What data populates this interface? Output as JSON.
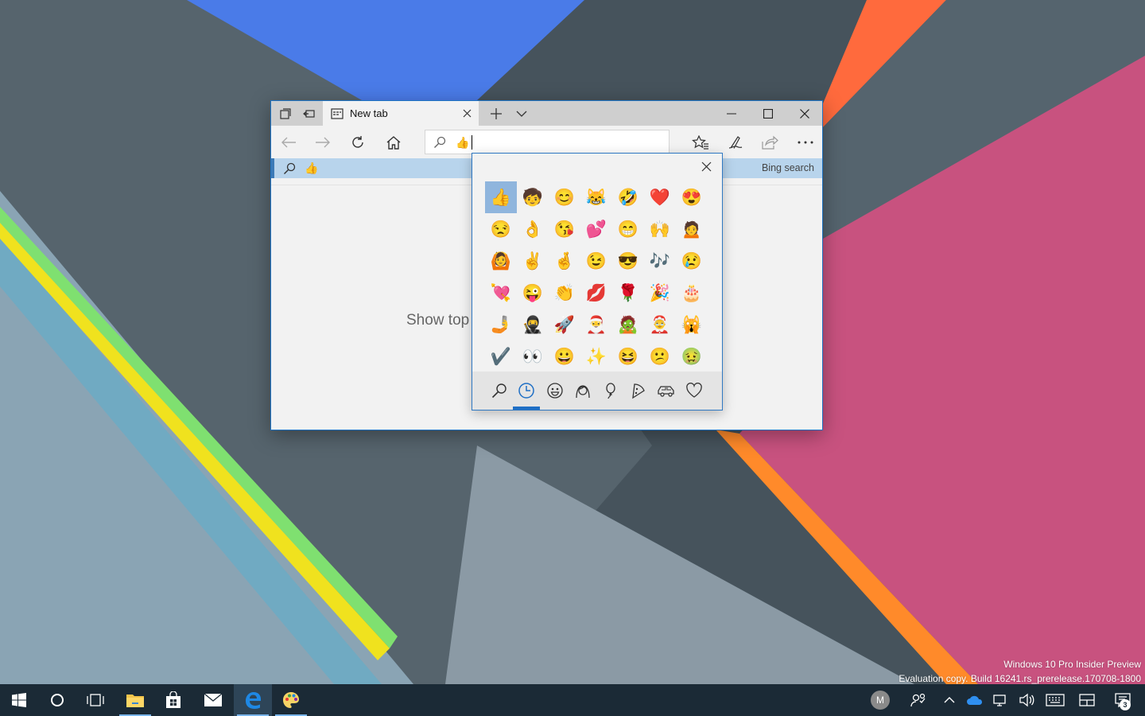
{
  "browser": {
    "tab_title": "New tab",
    "address_value": "👍",
    "suggestion_value": "👍",
    "suggestion_source": "Bing search",
    "content_text": "Show top s"
  },
  "emoji_panel": {
    "selected_emoji": "👍",
    "emojis": [
      "👍",
      "🧒",
      "😊",
      "😹",
      "🤣",
      "❤️",
      "😍",
      "😒",
      "👌",
      "😘",
      "💕",
      "😁",
      "🙌",
      "🙍",
      "🙆",
      "✌️",
      "🤞",
      "😉",
      "😎",
      "🎶",
      "😢",
      "💘",
      "😜",
      "👏",
      "💋",
      "🌹",
      "🎉",
      "🎂",
      "🤳",
      "🥷",
      "🚀",
      "🎅",
      "🧟",
      "🤶",
      "🙀",
      "✔️",
      "👀",
      "😀",
      "✨",
      "😆",
      "😕",
      "🤢"
    ],
    "category_tabs": [
      "search-icon",
      "clock-icon",
      "smiley-icon",
      "person-icon",
      "balloon-icon",
      "pizza-icon",
      "car-icon",
      "heart-icon"
    ]
  },
  "watermark": {
    "line1": "Windows 10 Pro Insider Preview",
    "line2": "Evaluation copy. Build 16241.rs_prerelease.170708-1800"
  },
  "taskbar": {
    "avatar_initial": "M",
    "notification_count": "3"
  },
  "colors": {
    "accent": "#1f6fc5",
    "taskbar": "#1b2a36",
    "selection": "#8fb5dd"
  }
}
